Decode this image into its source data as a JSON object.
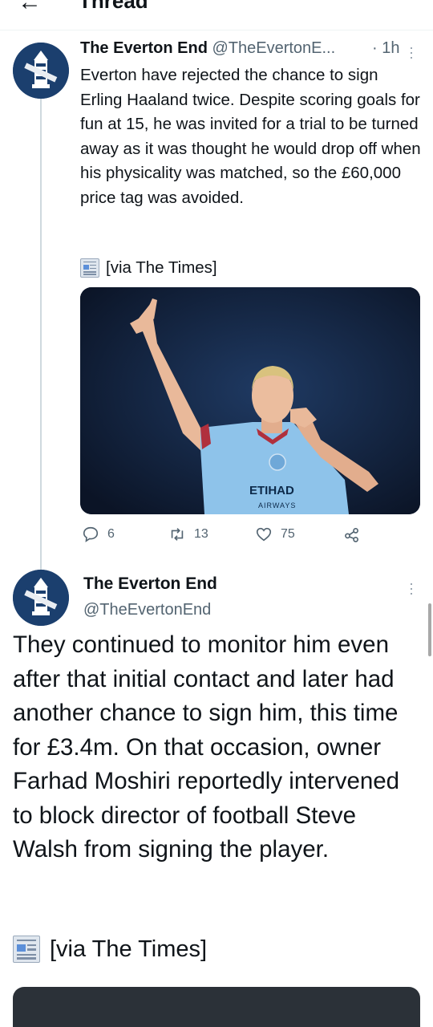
{
  "header": {
    "title": "Thread"
  },
  "tweet1": {
    "author_name": "The Everton End",
    "author_handle": "@TheEvertonE...",
    "time": "· 1h",
    "text": "Everton have rejected the chance to sign Erling Haaland twice. Despite scoring goals for fun at 15, he was invited for a trial to be turned away as it was thought he would drop off when his physicality was matched, so the £60,000 price tag was avoided.",
    "via": "[via The Times]",
    "shirt_sponsor": "ETIHAD",
    "shirt_sponsor_sub": "AIRWAYS",
    "replies": "6",
    "retweets": "13",
    "likes": "75"
  },
  "tweet2": {
    "author_name": "The Everton End",
    "author_handle": "@TheEvertonEnd",
    "text": "They continued to monitor him even after that initial contact and later had another chance to sign him, this time for £3.4m. On that occasion, owner Farhad Moshiri reportedly intervened to block director of football Steve Walsh from signing the player.",
    "via": "[via The Times]"
  },
  "colors": {
    "text": "#0f1419",
    "secondary": "#536471",
    "avatar_bg": "#1b3f6e",
    "shirt": "#8ec3ea"
  },
  "icons": [
    "back-arrow-icon",
    "more-icon",
    "newspaper-icon",
    "reply-icon",
    "retweet-icon",
    "like-icon",
    "share-icon"
  ]
}
